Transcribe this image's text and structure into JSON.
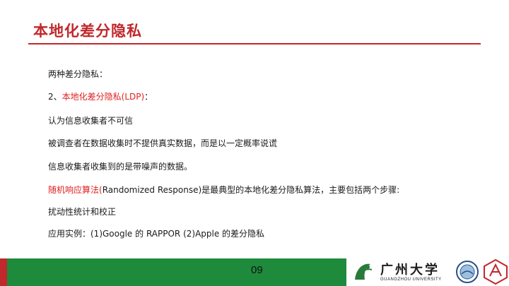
{
  "slide": {
    "title": "本地化差分隐私",
    "lines": [
      {
        "parts": [
          {
            "text": "两种差分隐私：",
            "red": false
          }
        ]
      },
      {
        "parts": [
          {
            "text": "2、",
            "red": false
          },
          {
            "text": "本地化差分隐私(LDP)",
            "red": true
          },
          {
            "text": "：",
            "red": false
          }
        ]
      },
      {
        "parts": [
          {
            "text": "认为信息收集者不可信",
            "red": false
          }
        ]
      },
      {
        "parts": [
          {
            "text": "被调查者在数据收集时不提供真实数据，而是以一定概率说谎",
            "red": false
          }
        ]
      },
      {
        "parts": [
          {
            "text": "信息收集者收集到的是带噪声的数据。",
            "red": false
          }
        ]
      },
      {
        "parts": [
          {
            "text": "随机响应算法(",
            "red": true
          },
          {
            "text": "Randomized Response)是最典型的本地化差分隐私算法，主要包括两个步骤:",
            "red": false
          }
        ]
      },
      {
        "parts": [
          {
            "text": "扰动性统计和校正",
            "red": false
          }
        ]
      },
      {
        "parts": [
          {
            "text": "应用实例：(1)Google 的 RAPPOR (2)Apple 的差分隐私",
            "red": false
          }
        ]
      }
    ]
  },
  "footer": {
    "page_number": "09",
    "university_name": "广州大学",
    "university_name_en": "GUANGZHOU UNIVERSITY"
  },
  "colors": {
    "title": "#c0282c",
    "highlight": "#e02020",
    "footer_green": "#1e8a3c",
    "footer_red": "#c0282c"
  }
}
